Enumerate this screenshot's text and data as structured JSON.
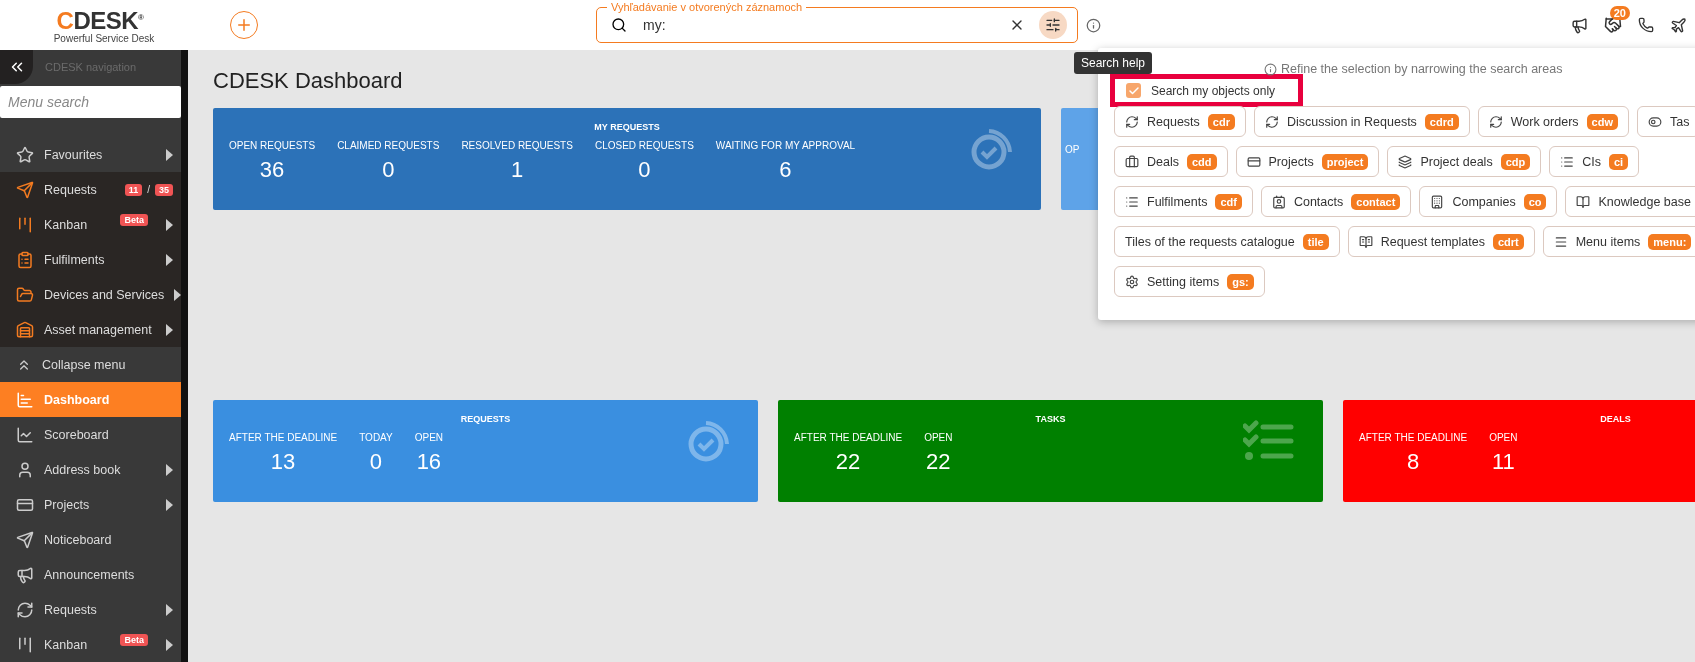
{
  "header": {
    "logo": {
      "wordmark": "CDESK",
      "mark": "®",
      "tagline": "Powerful Service Desk"
    },
    "search": {
      "legend": "Vyhľadávanie v otvorených záznamoch",
      "value": "my:"
    },
    "notification_count": "20"
  },
  "tooltip": "Search help",
  "sidebar": {
    "title": "CDESK navigation",
    "search": {
      "placeholder": "Menu search"
    },
    "favourites": {
      "label": "Favourites",
      "expandable": true
    },
    "favourite_items": [
      {
        "label": "Requests",
        "expandable": false,
        "badges": [
          "11",
          "35"
        ],
        "separator": "/"
      },
      {
        "label": "Kanban",
        "expandable": true,
        "tag": "Beta"
      },
      {
        "label": "Fulfilments",
        "expandable": true
      },
      {
        "label": "Devices and Services",
        "expandable": true
      },
      {
        "label": "Asset management",
        "expandable": true
      }
    ],
    "collapse": "Collapse menu",
    "items": [
      {
        "label": "Dashboard",
        "selected": true,
        "expandable": false
      },
      {
        "label": "Scoreboard",
        "selected": false,
        "expandable": false
      },
      {
        "label": "Address book",
        "selected": false,
        "expandable": true
      },
      {
        "label": "Projects",
        "selected": false,
        "expandable": true
      },
      {
        "label": "Noticeboard",
        "selected": false,
        "expandable": false
      },
      {
        "label": "Announcements",
        "selected": false,
        "expandable": false
      },
      {
        "label": "Requests",
        "selected": false,
        "expandable": true
      },
      {
        "label": "Kanban",
        "selected": false,
        "expandable": true,
        "tag": "Beta"
      }
    ]
  },
  "page_title": "CDESK Dashboard",
  "top_tiles": [
    {
      "kind": "requests",
      "title": "MY REQUESTS",
      "color": "#2c72b8",
      "metrics": [
        {
          "label": "OPEN REQUESTS",
          "value": "36"
        },
        {
          "label": "CLAIMED REQUESTS",
          "value": "0"
        },
        {
          "label": "RESOLVED REQUESTS",
          "value": "1"
        },
        {
          "label": "CLOSED REQUESTS",
          "value": "0"
        },
        {
          "label": "WAITING FOR MY APPROVAL",
          "value": "6"
        }
      ]
    },
    {
      "kind": "partial",
      "color": "#5ea3e8",
      "metrics": [
        {
          "label": "OP"
        }
      ]
    }
  ],
  "bottom_tiles": [
    {
      "kind": "requests",
      "title": "REQUESTS",
      "color": "#3a8fe0",
      "metrics": [
        {
          "label": "AFTER THE DEADLINE",
          "value": "13"
        },
        {
          "label": "TODAY",
          "value": "0"
        },
        {
          "label": "OPEN",
          "value": "16"
        }
      ]
    },
    {
      "kind": "tasks",
      "title": "TASKS",
      "color": "#008000",
      "metrics": [
        {
          "label": "AFTER THE DEADLINE",
          "value": "22"
        },
        {
          "label": "OPEN",
          "value": "22"
        }
      ]
    },
    {
      "kind": "deals",
      "title": "DEALS",
      "color": "#ff0000",
      "metrics": [
        {
          "label": "AFTER THE DEADLINE",
          "value": "8"
        },
        {
          "label": "OPEN",
          "value": "11"
        }
      ]
    }
  ],
  "search_help": {
    "hint": "Refine the selection by narrowing the search areas",
    "my_objects": {
      "label": "Search my objects only",
      "checked": true
    },
    "area_rows": [
      [
        {
          "label": "Requests",
          "shortcut": "cdr"
        },
        {
          "label": "Discussion in Requests",
          "shortcut": "cdrd"
        },
        {
          "label": "Work orders",
          "shortcut": "cdw"
        },
        {
          "label": "Tas"
        }
      ],
      [
        {
          "label": "Deals",
          "shortcut": "cdd"
        },
        {
          "label": "Projects",
          "shortcut": "project"
        },
        {
          "label": "Project deals",
          "shortcut": "cdp"
        },
        {
          "label": "CIs",
          "shortcut": "ci"
        }
      ],
      [
        {
          "label": "Fulfilments",
          "shortcut": "cdf"
        },
        {
          "label": "Contacts",
          "shortcut": "contact"
        },
        {
          "label": "Companies",
          "shortcut": "co"
        },
        {
          "label": "Knowledge base"
        }
      ],
      [
        {
          "label": "Tiles of the requests catalogue",
          "shortcut": "tile"
        },
        {
          "label": "Request templates",
          "shortcut": "cdrt"
        },
        {
          "label": "Menu items",
          "shortcut": "menu:"
        }
      ],
      [
        {
          "label": "Setting items",
          "shortcut": "gs:"
        }
      ]
    ]
  }
}
